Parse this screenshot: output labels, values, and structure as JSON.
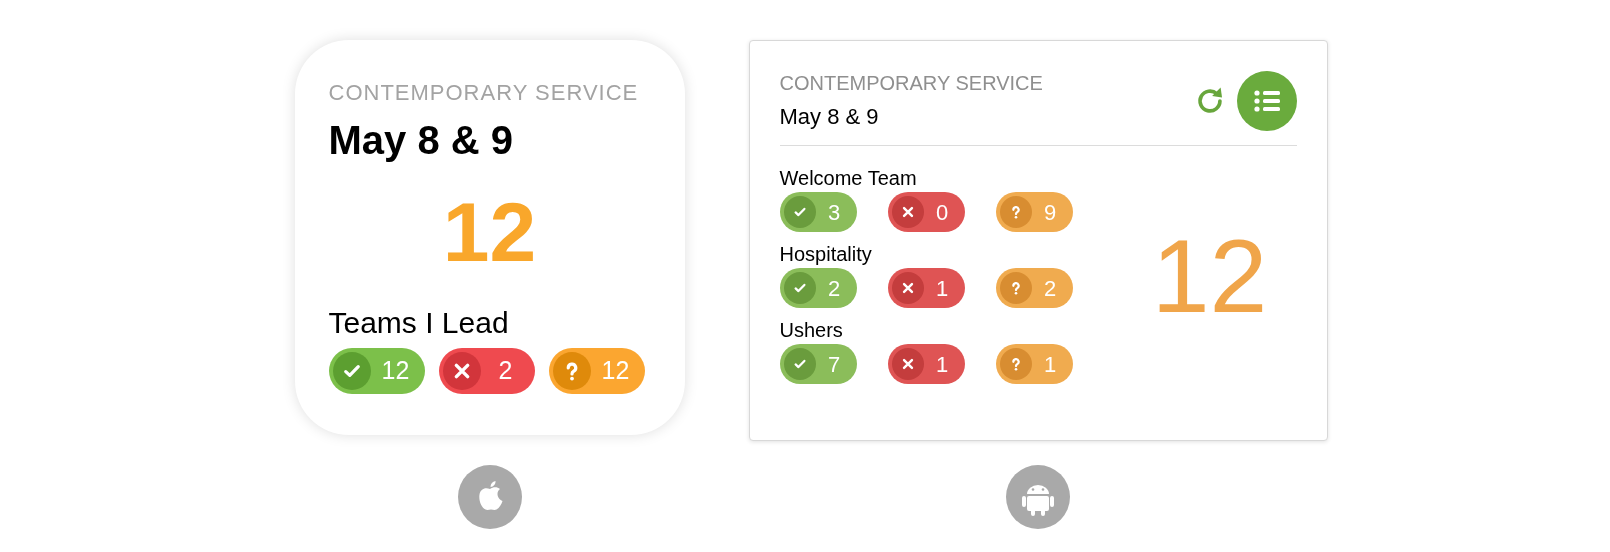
{
  "ios_widget": {
    "eyebrow": "CONTEMPORARY SERVICE",
    "title": "May 8 & 9",
    "total": "12",
    "section_title": "Teams I Lead",
    "counts": [
      {
        "kind": "accepted",
        "value": "12"
      },
      {
        "kind": "declined",
        "value": "2"
      },
      {
        "kind": "pending",
        "value": "12"
      }
    ]
  },
  "android_widget": {
    "eyebrow": "CONTEMPORARY SERVICE",
    "title": "May 8 & 9",
    "total": "12",
    "teams": [
      {
        "name": "Welcome Team",
        "counts": [
          {
            "kind": "accepted",
            "value": "3"
          },
          {
            "kind": "declined",
            "value": "0"
          },
          {
            "kind": "pending",
            "value": "9"
          }
        ]
      },
      {
        "name": "Hospitality",
        "counts": [
          {
            "kind": "accepted",
            "value": "2"
          },
          {
            "kind": "declined",
            "value": "1"
          },
          {
            "kind": "pending",
            "value": "2"
          }
        ]
      },
      {
        "name": "Ushers",
        "counts": [
          {
            "kind": "accepted",
            "value": "7"
          },
          {
            "kind": "declined",
            "value": "1"
          },
          {
            "kind": "pending",
            "value": "1"
          }
        ]
      }
    ]
  },
  "platforms": [
    {
      "kind": "apple"
    },
    {
      "kind": "android"
    }
  ]
}
